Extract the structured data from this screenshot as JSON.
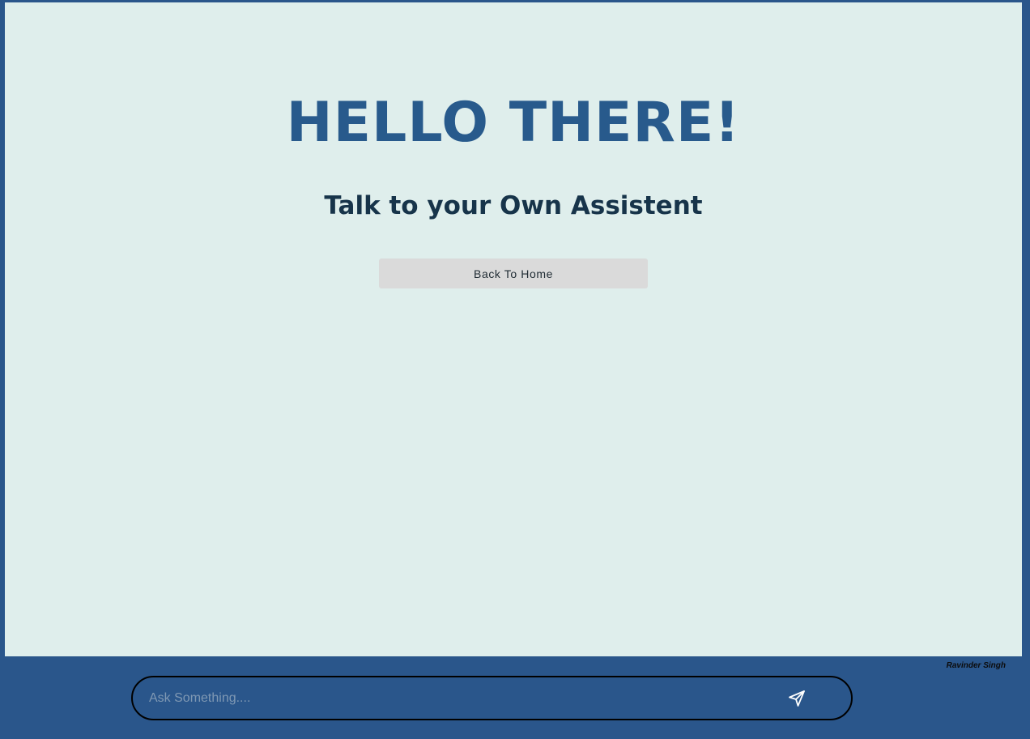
{
  "hero": {
    "title": "HELLO THERE!",
    "subtitle": "Talk to your Own Assistent"
  },
  "actions": {
    "back_home_label": "Back To Home"
  },
  "chat": {
    "placeholder": "Ask Something....",
    "send_icon": "send-paper-plane-icon"
  },
  "footer": {
    "credit": "Ravinder Singh"
  },
  "colors": {
    "background_frame": "#2a568b",
    "panel": "#dfeeec",
    "title": "#285a8c",
    "subtitle": "#17344a",
    "button": "#dadada"
  }
}
